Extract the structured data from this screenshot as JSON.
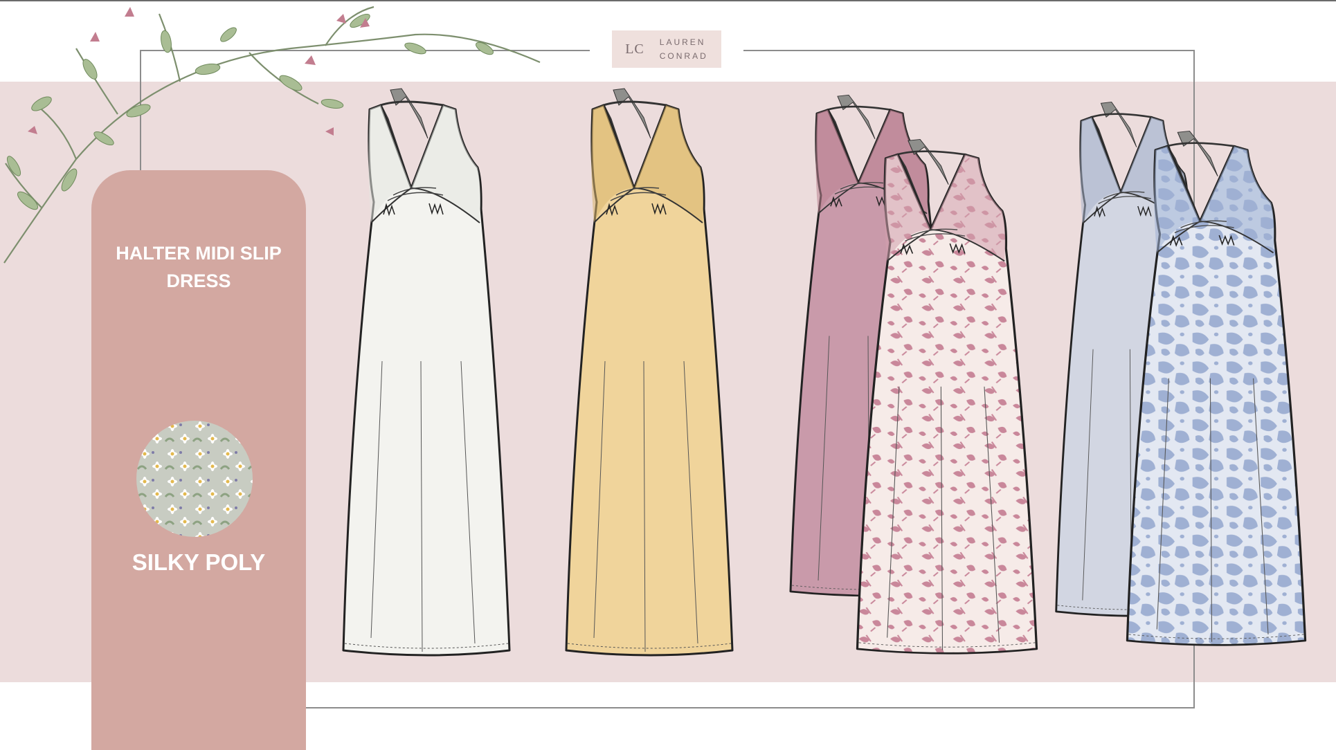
{
  "brand": {
    "monogram": "LC",
    "name_line1": "LAUREN",
    "name_line2": "CONRAD"
  },
  "product": {
    "title": "HALTER MIDI SLIP DRESS"
  },
  "fabric": {
    "name": "SILKY POLY"
  },
  "colors": {
    "band": "#ecdcdc",
    "panel": "#d3a8a1",
    "ivory": "#f3f3ef",
    "butter_yellow": "#f0d49b",
    "mauve": "#c99aaa",
    "pink_floral_print": "#f5e8e6",
    "powder_blue": "#d2d6e2",
    "blue_floral_print": "#c5cfe3"
  },
  "dress_colorways": [
    {
      "name": "ivory",
      "color": "#f3f3ef"
    },
    {
      "name": "butter-yellow",
      "color": "#f0d49b"
    },
    {
      "name": "mauve",
      "color": "#c99aaa"
    },
    {
      "name": "pink-floral-print",
      "color": "#f5e8e6"
    },
    {
      "name": "powder-blue",
      "color": "#d2d6e2"
    },
    {
      "name": "blue-floral-print",
      "color": "#c5cfe3"
    }
  ]
}
